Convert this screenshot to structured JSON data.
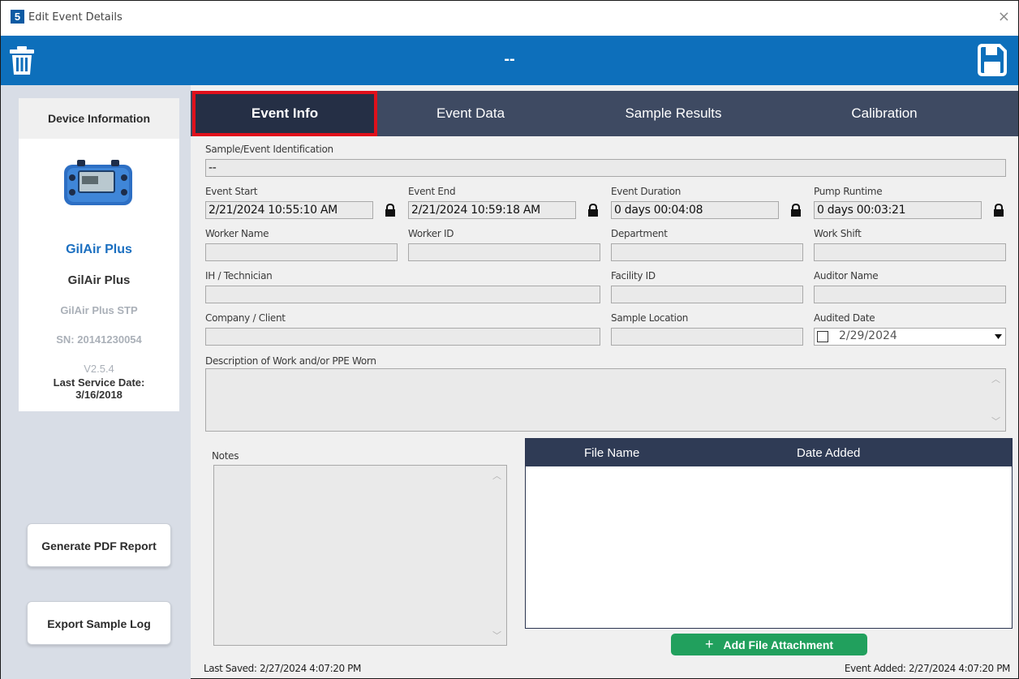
{
  "window": {
    "title": "Edit Event Details",
    "app_icon_letter": "5",
    "close_glyph": "×"
  },
  "header": {
    "title": "--",
    "accent_color": "#0d6fbb"
  },
  "device": {
    "heading": "Device Information",
    "name_highlight": "GilAir Plus",
    "name": "GilAir Plus",
    "model": "GilAir Plus STP",
    "serial": "SN: 20141230054",
    "version": "V2.5.4",
    "last_service_label": "Last Service Date:",
    "last_service_date": "3/16/2018"
  },
  "left_buttons": {
    "pdf": "Generate PDF Report",
    "export": "Export Sample Log"
  },
  "tabs": [
    {
      "label": "Event Info",
      "active": true
    },
    {
      "label": "Event Data"
    },
    {
      "label": "Sample Results"
    },
    {
      "label": "Calibration"
    }
  ],
  "form": {
    "sample_id": {
      "label": "Sample/Event Identification",
      "value": "--"
    },
    "event_start": {
      "label": "Event Start",
      "value": "2/21/2024 10:55:10 AM"
    },
    "event_end": {
      "label": "Event End",
      "value": "2/21/2024 10:59:18 AM"
    },
    "event_duration": {
      "label": "Event Duration",
      "value": "0 days 00:04:08"
    },
    "pump_runtime": {
      "label": "Pump Runtime",
      "value": "0 days 00:03:21"
    },
    "worker_name": {
      "label": "Worker Name",
      "value": ""
    },
    "worker_id": {
      "label": "Worker ID",
      "value": ""
    },
    "department": {
      "label": "Department",
      "value": ""
    },
    "work_shift": {
      "label": "Work Shift",
      "value": ""
    },
    "technician": {
      "label": "IH / Technician",
      "value": ""
    },
    "facility_id": {
      "label": "Facility ID",
      "value": ""
    },
    "auditor_name": {
      "label": "Auditor Name",
      "value": ""
    },
    "company": {
      "label": "Company / Client",
      "value": ""
    },
    "sample_location": {
      "label": "Sample Location",
      "value": ""
    },
    "audited_date": {
      "label": "Audited Date",
      "value": "2/29/2024",
      "checked": false
    },
    "description": {
      "label": "Description of Work and/or PPE Worn",
      "value": ""
    },
    "notes": {
      "label": "Notes",
      "value": ""
    }
  },
  "files": {
    "columns": [
      "File Name",
      "Date Added"
    ],
    "rows": [],
    "add_label": "Add File Attachment"
  },
  "footer": {
    "last_saved": "Last Saved: 2/27/2024 4:07:20 PM",
    "event_added": "Event Added: 2/27/2024 4:07:20 PM"
  },
  "icons": [
    "app-icon",
    "trash-icon",
    "save-icon",
    "lock-icon",
    "device-image",
    "plus-icon",
    "dropdown-arrow-icon"
  ]
}
